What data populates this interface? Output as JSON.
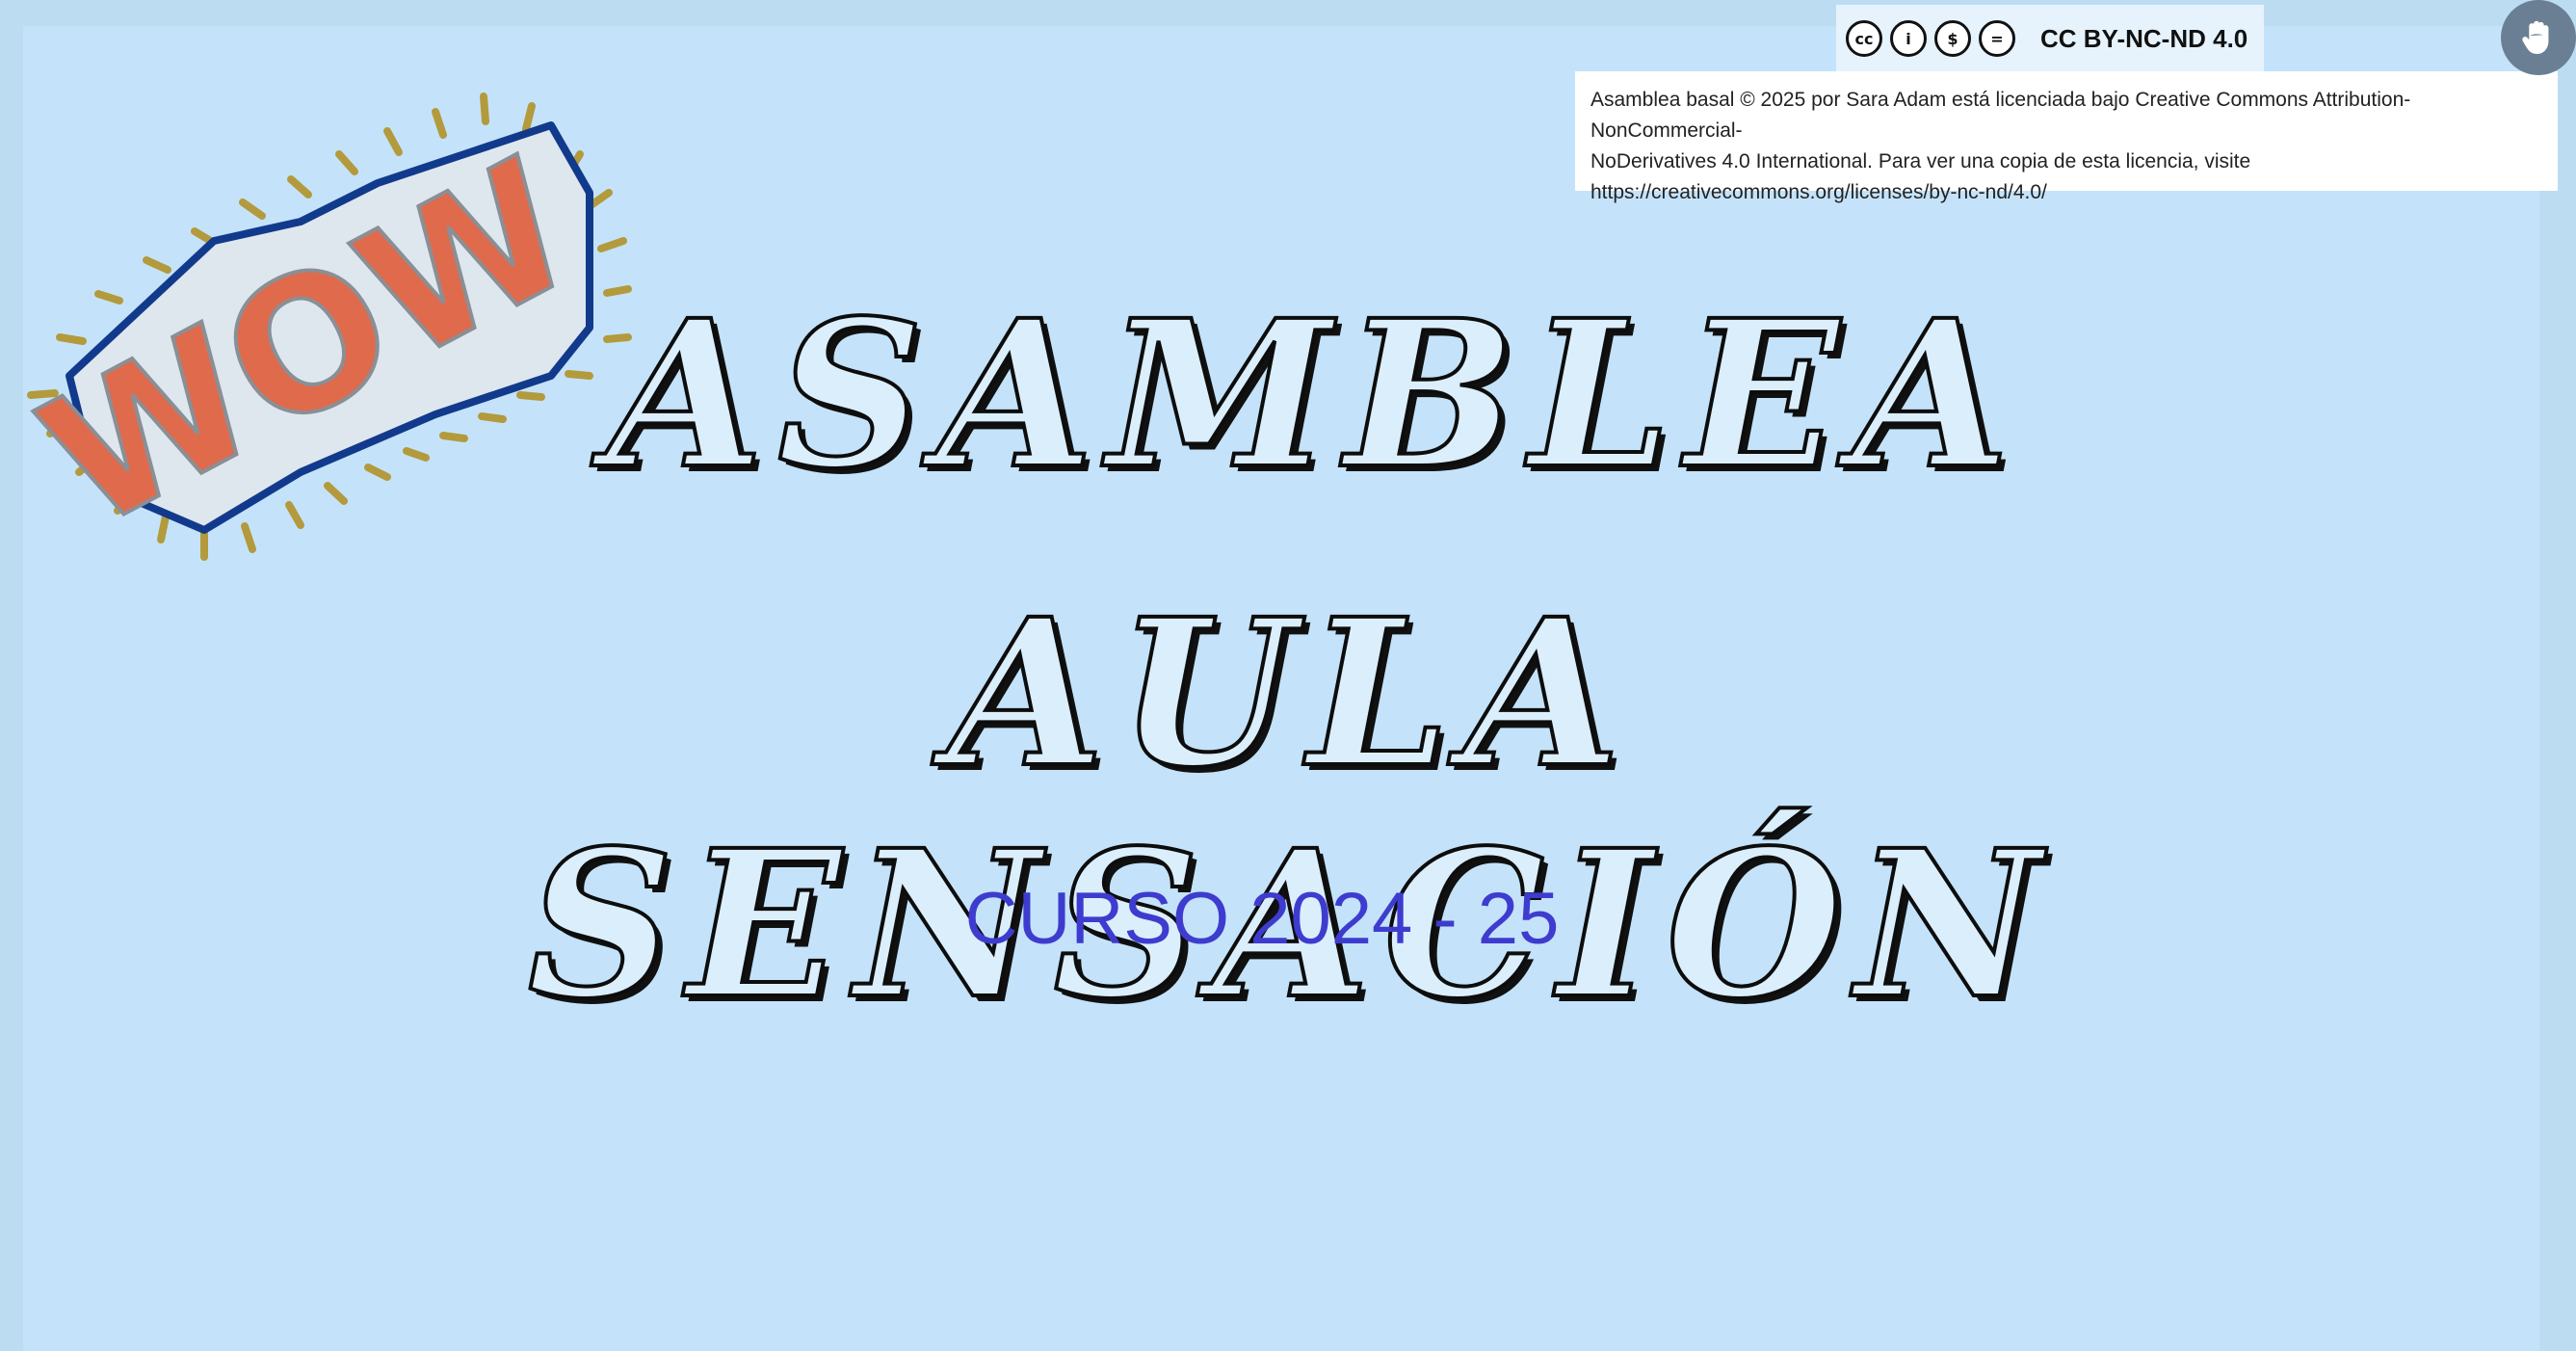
{
  "license": {
    "badge_label": "CC BY-NC-ND 4.0",
    "icons": [
      "cc-icon",
      "by-icon",
      "nc-icon",
      "nd-icon"
    ],
    "icon_glyphs": [
      "cc",
      "i",
      "$",
      "="
    ],
    "text_line1": "Asamblea basal © 2025 por Sara Adam está licenciada bajo Creative Commons Attribution-NonCommercial-",
    "text_line2": "NoDerivatives 4.0 International. Para ver una copia de esta licencia, visite",
    "text_line3": "https://creativecommons.org/licenses/by-nc-nd/4.0/"
  },
  "toolbar": {
    "hand_icon": "hand-icon"
  },
  "sticker": {
    "text": "WOW",
    "colors": {
      "fill": "#e06a4c",
      "outline": "#123a8c",
      "rays": "#b39a3c"
    }
  },
  "slide": {
    "title_line1": "ASAMBLEA",
    "title_line2": "AULA SENSACIÓN",
    "subtitle": "CURSO 2024 - 25"
  },
  "colors": {
    "background": "#c4e3fa",
    "subtitle": "#3e3ccf",
    "title": "#111111"
  }
}
